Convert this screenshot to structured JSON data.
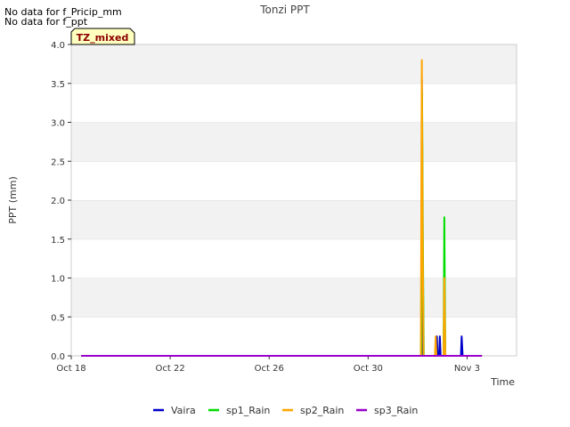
{
  "notes": [
    "No data for f_Pricip_mm",
    "No data for f_ppt"
  ],
  "chart_data": {
    "type": "line",
    "title": "Tonzi PPT",
    "xlabel": "Time",
    "ylabel": "PPT (mm)",
    "tag_label": "TZ_mixed",
    "ylim": [
      0,
      4.0
    ],
    "y_ticks": [
      0.0,
      0.5,
      1.0,
      1.5,
      2.0,
      2.5,
      3.0,
      3.5,
      4.0
    ],
    "y_tick_labels": [
      "0.0",
      "0.5",
      "1.0",
      "1.5",
      "2.0",
      "2.5",
      "3.0",
      "3.5",
      "4.0"
    ],
    "xlim": [
      "Oct 18",
      "Nov 5"
    ],
    "x_ticks": [
      {
        "label": "Oct 18",
        "day": 0
      },
      {
        "label": "Oct 22",
        "day": 4
      },
      {
        "label": "Oct 26",
        "day": 8
      },
      {
        "label": "Oct 30",
        "day": 12
      },
      {
        "label": "Nov 3",
        "day": 16
      }
    ],
    "grid": true,
    "legend_position": "bottom",
    "series": [
      {
        "name": "Vaira",
        "color": "#0000cc",
        "points": [
          [
            0.4,
            0
          ],
          [
            14.15,
            0
          ],
          [
            14.17,
            3.55
          ],
          [
            14.2,
            0
          ],
          [
            14.75,
            0
          ],
          [
            14.78,
            0.25
          ],
          [
            14.81,
            0
          ],
          [
            14.87,
            0
          ],
          [
            14.9,
            0.25
          ],
          [
            14.93,
            0
          ],
          [
            15.75,
            0
          ],
          [
            15.78,
            0.25
          ],
          [
            15.82,
            0
          ],
          [
            16.6,
            0
          ]
        ]
      },
      {
        "name": "sp1_Rain",
        "color": "#00dd00",
        "points": [
          [
            0.4,
            0
          ],
          [
            14.15,
            0
          ],
          [
            14.18,
            3.4
          ],
          [
            14.22,
            1.2
          ],
          [
            14.25,
            0
          ],
          [
            15.05,
            0
          ],
          [
            15.08,
            1.78
          ],
          [
            15.12,
            0
          ],
          [
            16.6,
            0
          ]
        ]
      },
      {
        "name": "sp2_Rain",
        "color": "#ffa500",
        "points": [
          [
            0.4,
            0
          ],
          [
            14.13,
            0
          ],
          [
            14.17,
            3.8
          ],
          [
            14.21,
            1.3
          ],
          [
            14.24,
            0
          ],
          [
            14.7,
            0
          ],
          [
            14.73,
            0.25
          ],
          [
            14.76,
            0
          ],
          [
            15.05,
            0
          ],
          [
            15.08,
            1.0
          ],
          [
            15.12,
            0
          ],
          [
            16.6,
            0
          ]
        ]
      },
      {
        "name": "sp3_Rain",
        "color": "#9900cc",
        "points": [
          [
            0.4,
            0
          ],
          [
            16.6,
            0
          ]
        ]
      }
    ]
  }
}
